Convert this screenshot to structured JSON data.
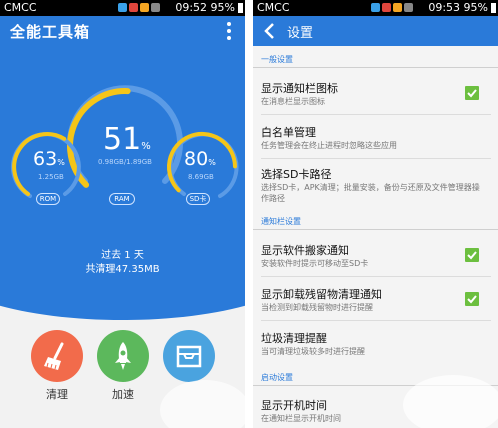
{
  "left_screen": {
    "status_bar": {
      "carrier": "CMCC",
      "time": "09:52 95%"
    },
    "app_title": "全能工具箱",
    "gauges": {
      "center": {
        "value": "51",
        "unit": "%",
        "detail": "0.98GB/1.89GB",
        "label": "RAM",
        "level": 0.51
      },
      "left": {
        "value": "63",
        "unit": "%",
        "detail": "1.25GB",
        "label": "ROM",
        "level": 0.63
      },
      "right": {
        "value": "80",
        "unit": "%",
        "detail": "8.69GB",
        "label": "SD卡",
        "level": 0.8
      }
    },
    "summary": {
      "period": "过去 1 天",
      "cleaned": "共清理47.35MB"
    },
    "actions": [
      {
        "label": "清理",
        "icon": "broom-icon",
        "color": "#f26b4b"
      },
      {
        "label": "加速",
        "icon": "rocket-icon",
        "color": "#5cb85c"
      },
      {
        "label": "",
        "icon": "box-icon",
        "color": "#4aa3df"
      }
    ]
  },
  "right_screen": {
    "status_bar": {
      "carrier": "CMCC",
      "time": "09:53 95%"
    },
    "title": "设置",
    "sections": [
      {
        "header": "一般设置",
        "items": [
          {
            "title": "显示通知栏图标",
            "subtitle": "在消息栏显示图标",
            "checked": true
          },
          {
            "title": "白名单管理",
            "subtitle": "任务管理会在终止进程时忽略这些应用",
            "checked": false
          },
          {
            "title": "选择SD卡路径",
            "subtitle": "选择SD卡，APK清理；批量安装，备份与还原及文件管理器操作路径",
            "checked": false
          }
        ]
      },
      {
        "header": "通知栏设置",
        "items": [
          {
            "title": "显示软件搬家通知",
            "subtitle": "安装软件时提示可移动至SD卡",
            "checked": true
          },
          {
            "title": "显示卸载残留物清理通知",
            "subtitle": "当检测到卸载残留物时进行提醒",
            "checked": true
          },
          {
            "title": "垃圾清理提醒",
            "subtitle": "当可清理垃圾较多时进行提醒",
            "checked": false
          }
        ]
      },
      {
        "header": "启动设置",
        "items": [
          {
            "title": "显示开机时间",
            "subtitle": "在通知栏显示开机时间",
            "checked": false
          }
        ]
      }
    ]
  },
  "colors": {
    "primary_blue": "#2a7ad9",
    "gauge_yellow": "#f5c518",
    "check_green": "#6cbf3f"
  }
}
